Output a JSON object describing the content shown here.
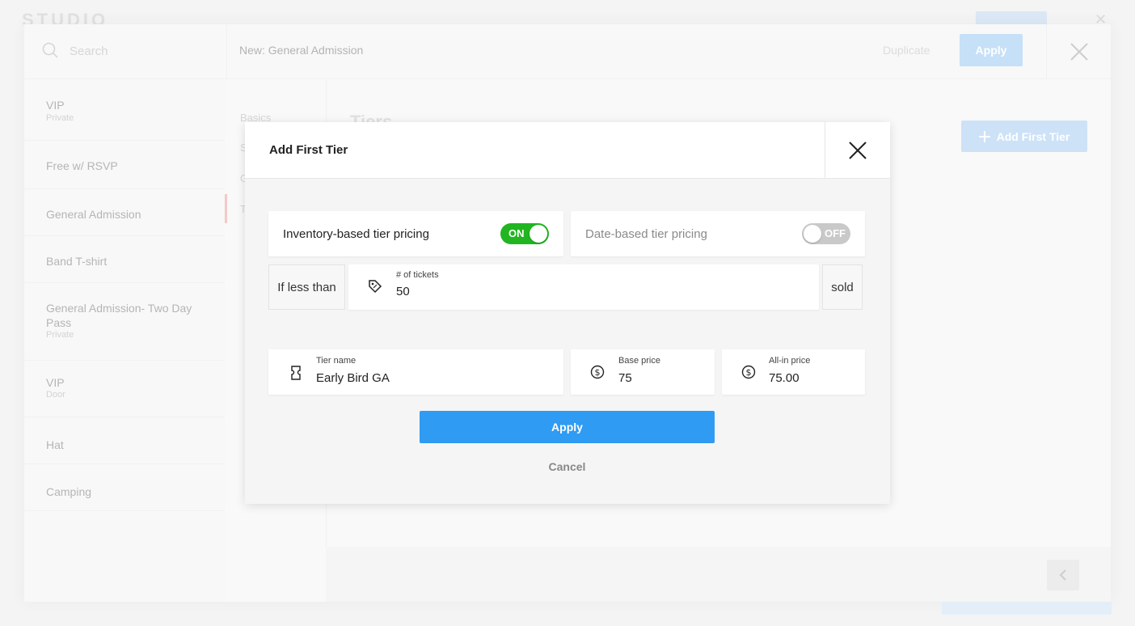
{
  "app": {
    "logo": "STUDIO"
  },
  "panel": {
    "search_placeholder": "Search",
    "title": "New: General Admission",
    "duplicate_label": "Duplicate",
    "apply_label": "Apply"
  },
  "sidebar": {
    "items": [
      {
        "label": "VIP",
        "sub": "Private"
      },
      {
        "label": "Free w/ RSVP",
        "sub": ""
      },
      {
        "label": "General Admission",
        "sub": ""
      },
      {
        "label": "Band T-shirt",
        "sub": ""
      },
      {
        "label": "General Admission- Two Day Pass",
        "sub": "Private"
      },
      {
        "label": "VIP",
        "sub": "Door"
      },
      {
        "label": "Hat",
        "sub": ""
      },
      {
        "label": "Camping",
        "sub": ""
      }
    ]
  },
  "midnav": {
    "items": [
      "Basics",
      "S",
      "G",
      "T"
    ]
  },
  "main": {
    "heading": "Tiers",
    "add_first_tier_label": "Add First Tier"
  },
  "modal": {
    "title": "Add First Tier",
    "inventory_label": "Inventory-based tier pricing",
    "inventory_toggle": "ON",
    "date_label": "Date-based tier pricing",
    "date_toggle": "OFF",
    "if_less_than": "If less than",
    "tickets_label": "# of tickets",
    "tickets_value": "50",
    "sold": "sold",
    "tier_name_label": "Tier name",
    "tier_name_value": "Early Bird GA",
    "base_price_label": "Base price",
    "base_price_value": "75",
    "allin_price_label": "All-in price",
    "allin_price_value": "75.00",
    "apply_label": "Apply",
    "cancel_label": "Cancel"
  },
  "colors": {
    "accent": "#2f9bf2",
    "toggle_on": "#21b521",
    "toggle_off": "#c9c9c9"
  },
  "icons": [
    "search-icon",
    "close-icon",
    "plus-icon",
    "tag-icon",
    "ticket-icon",
    "dollar-icon",
    "chevron-left-icon"
  ]
}
